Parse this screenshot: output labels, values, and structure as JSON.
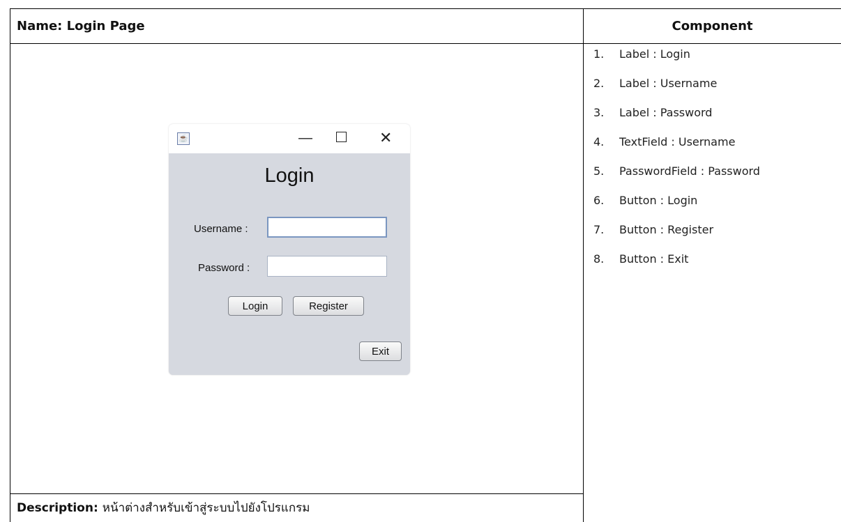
{
  "header": {
    "name_label": "Name: Login Page",
    "component_label": "Component"
  },
  "window": {
    "icon": "java-icon",
    "title": "Login",
    "username_label": "Username :",
    "password_label": "Password :",
    "username_value": "",
    "password_value": "",
    "login_button": "Login",
    "register_button": "Register",
    "exit_button": "Exit"
  },
  "components": [
    {
      "num": "1.",
      "text": "Label : Login"
    },
    {
      "num": "2.",
      "text": "Label : Username"
    },
    {
      "num": "3.",
      "text": "Label : Password"
    },
    {
      "num": "4.",
      "text": "TextField : Username"
    },
    {
      "num": "5.",
      "text": "PasswordField : Password"
    },
    {
      "num": "6.",
      "text": "Button : Login"
    },
    {
      "num": "7.",
      "text": "Button : Register"
    },
    {
      "num": "8.",
      "text": "Button : Exit"
    }
  ],
  "description": {
    "label": "Description:",
    "text": "หน้าต่างสำหรับเข้าสู่ระบบไปยังโปรแกรม"
  }
}
